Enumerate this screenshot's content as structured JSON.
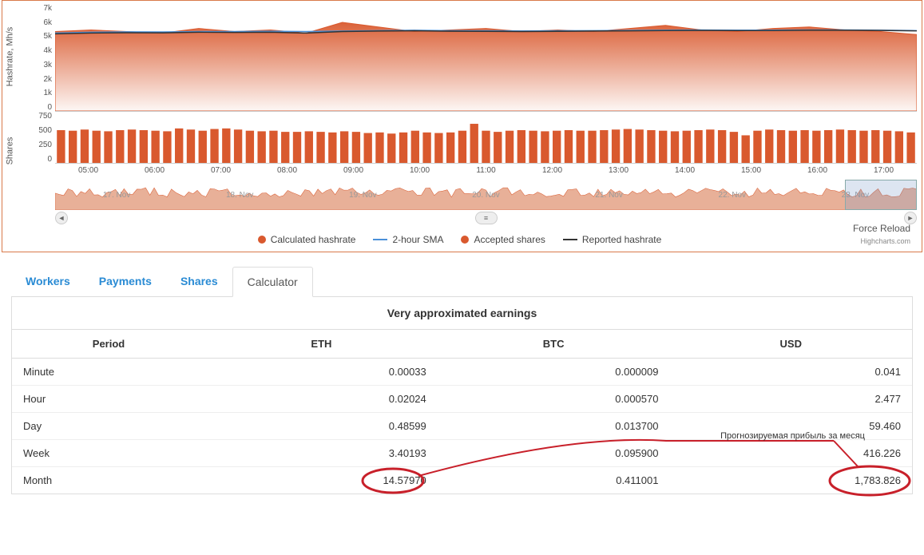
{
  "chart_data": [
    {
      "type": "area",
      "ylabel": "Hashrate, Mh/s",
      "ylim": [
        0,
        7000
      ],
      "yticks": [
        "7k",
        "6k",
        "5k",
        "4k",
        "3k",
        "2k",
        "1k",
        "0"
      ],
      "x": [
        "05:00",
        "06:00",
        "07:00",
        "08:00",
        "09:00",
        "10:00",
        "11:00",
        "12:00",
        "13:00",
        "14:00",
        "15:00",
        "16:00",
        "17:00"
      ],
      "series": [
        {
          "name": "Calculated hashrate",
          "color": "#d9592e",
          "values": [
            5200,
            5300,
            5200,
            5100,
            5400,
            5200,
            5300,
            5100,
            5800,
            5500,
            5200,
            5300,
            5400,
            5200,
            5300,
            5200,
            5400,
            5600,
            5300,
            5200,
            5400,
            5500,
            5300,
            5200,
            5000
          ]
        },
        {
          "name": "2-hour SMA",
          "color": "#4a90d9",
          "values": [
            5100,
            5150,
            5180,
            5170,
            5200,
            5200,
            5220,
            5200,
            5230,
            5260,
            5280,
            5260,
            5250,
            5240,
            5250,
            5260,
            5270,
            5290,
            5300,
            5290,
            5290,
            5300,
            5300,
            5290,
            5260
          ]
        },
        {
          "name": "Reported hashrate",
          "color": "#333333",
          "values": [
            5050,
            5100,
            5120,
            5110,
            5150,
            5140,
            5150,
            5100,
            5200,
            5230,
            5250,
            5220,
            5210,
            5200,
            5210,
            5230,
            5240,
            5260,
            5270,
            5260,
            5260,
            5280,
            5280,
            5270,
            5240
          ]
        }
      ]
    },
    {
      "type": "bar",
      "ylabel": "Shares",
      "ylim": [
        0,
        750
      ],
      "yticks": [
        "750",
        "500",
        "250",
        "0"
      ],
      "series": [
        {
          "name": "Accepted shares",
          "color": "#d9592e",
          "values": [
            570,
            560,
            580,
            560,
            550,
            570,
            580,
            570,
            560,
            550,
            600,
            580,
            560,
            590,
            600,
            580,
            560,
            550,
            560,
            540,
            540,
            550,
            540,
            530,
            550,
            540,
            520,
            530,
            510,
            530,
            560,
            530,
            520,
            530,
            560,
            680,
            560,
            540,
            560,
            570,
            560,
            550,
            560,
            570,
            560,
            560,
            570,
            580,
            590,
            580,
            570,
            560,
            550,
            560,
            570,
            580,
            570,
            540,
            480,
            560,
            580,
            570,
            560,
            570,
            560,
            570,
            580,
            570,
            560,
            570,
            560,
            550,
            530
          ]
        }
      ]
    }
  ],
  "navigator": {
    "dates": [
      "17. Nov",
      "18. Nov",
      "19. Nov",
      "20. Nov",
      "21. Nov",
      "22. Nov",
      "23. Nov"
    ]
  },
  "legend": {
    "calculated": "Calculated hashrate",
    "sma": "2-hour SMA",
    "accepted": "Accepted shares",
    "reported": "Reported hashrate"
  },
  "force_reload": "Force Reload",
  "highcharts": "Highcharts.com",
  "tabs": {
    "workers": "Workers",
    "payments": "Payments",
    "shares": "Shares",
    "calculator": "Calculator"
  },
  "table": {
    "title": "Very approximated earnings",
    "headers": {
      "period": "Period",
      "eth": "ETH",
      "btc": "BTC",
      "usd": "USD"
    },
    "rows": [
      {
        "period": "Minute",
        "eth": "0.00033",
        "btc": "0.000009",
        "usd": "0.041"
      },
      {
        "period": "Hour",
        "eth": "0.02024",
        "btc": "0.000570",
        "usd": "2.477"
      },
      {
        "period": "Day",
        "eth": "0.48599",
        "btc": "0.013700",
        "usd": "59.460"
      },
      {
        "period": "Week",
        "eth": "3.40193",
        "btc": "0.095900",
        "usd": "416.226"
      },
      {
        "period": "Month",
        "eth": "14.57970",
        "btc": "0.411001",
        "usd": "1,783.826"
      }
    ]
  },
  "annotation_text": "Прогнозируемая прибыль за месяц"
}
